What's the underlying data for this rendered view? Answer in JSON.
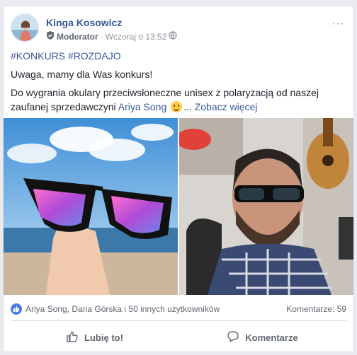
{
  "post": {
    "author": "Kinga Kosowicz",
    "role": "Moderator",
    "time": "Wczoraj o 13:52",
    "more_label": "···",
    "hashtags": "#KONKURS #ROZDAJO",
    "line1": "Uwaga, mamy dla Was konkurs!",
    "line2_text": "Do wygrania okulary przeciwsłoneczne unisex z polaryzacją od naszej zaufanej sprzedawczyni",
    "mention": "Ariya Song",
    "ellipsis": "...",
    "see_more": "Zobacz więcej"
  },
  "reactions": {
    "likes_text": "Ariya Song, Daria Górska i 50 innych użytkowników",
    "comments_text": "Komentarze: 59"
  },
  "actions": {
    "like_label": "Lubię to!",
    "comment_label": "Komentarze"
  },
  "colors": {
    "link": "#365899",
    "like_badge": "#4a7ef0"
  },
  "icons": [
    "moderator-badge-icon",
    "globe-icon",
    "like-reaction-icon",
    "thumbs-up-icon",
    "comment-icon",
    "smile-emoji-icon"
  ]
}
